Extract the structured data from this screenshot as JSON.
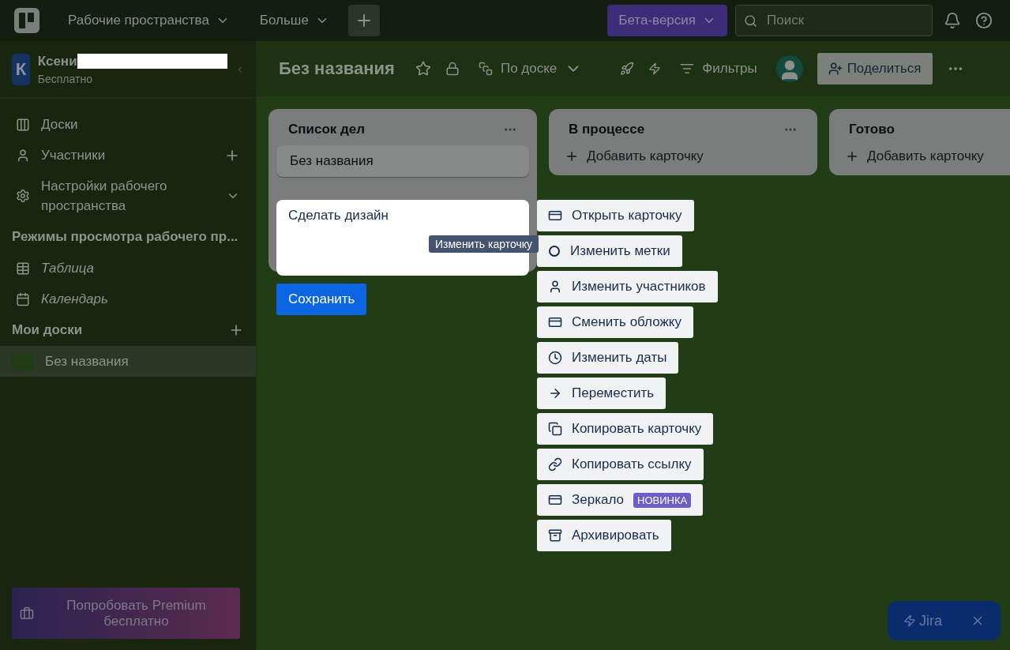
{
  "topbar": {
    "workspaces": "Рабочие пространства",
    "more": "Больше",
    "beta": "Бета-версия",
    "search": {
      "placeholder": "Поиск"
    }
  },
  "sidebar": {
    "avatar": "К",
    "workspace": "Ксени",
    "plan": "Бесплатно",
    "nav": [
      {
        "label": "Доски",
        "kind": "boards"
      },
      {
        "label": "Участники",
        "kind": "members"
      },
      {
        "label": "Настройки рабочего пространства",
        "kind": "settings"
      }
    ],
    "views_heading": "Режимы просмотра рабочего пр...",
    "views": [
      {
        "label": "Таблица",
        "kind": "table"
      },
      {
        "label": "Календарь",
        "kind": "calendar"
      }
    ],
    "boards_heading": "Мои доски",
    "boards": [
      {
        "label": "Без названия",
        "selected": true
      }
    ],
    "premium": "Попробовать Premium бесплатно"
  },
  "board": {
    "title": "Без названия",
    "view": "По доске",
    "filters": "Фильтры",
    "share": "Поделиться"
  },
  "lists": [
    {
      "title": "Список дел",
      "cards": [
        "Без названия"
      ]
    },
    {
      "title": "В процессе",
      "add_card": "Добавить карточку"
    },
    {
      "title": "Готово",
      "add_card": "Добавить карточку"
    }
  ],
  "editor": {
    "text": "Сделать дизайн",
    "save": "Сохранить",
    "tooltip": "Изменить карточку"
  },
  "menu": [
    {
      "label": "Открыть карточку",
      "kind": "card"
    },
    {
      "label": "Изменить метки",
      "kind": "label"
    },
    {
      "label": "Изменить участников",
      "kind": "member"
    },
    {
      "label": "Сменить обложку",
      "kind": "cover"
    },
    {
      "label": "Изменить даты",
      "kind": "clock"
    },
    {
      "label": "Переместить",
      "kind": "move"
    },
    {
      "label": "Копировать карточку",
      "kind": "copy"
    },
    {
      "label": "Копировать ссылку",
      "kind": "link"
    },
    {
      "label": "Зеркало",
      "kind": "card",
      "badge": "НОВИНКА"
    },
    {
      "label": "Архивировать",
      "kind": "archive"
    }
  ],
  "jira": {
    "label": "Jira"
  }
}
